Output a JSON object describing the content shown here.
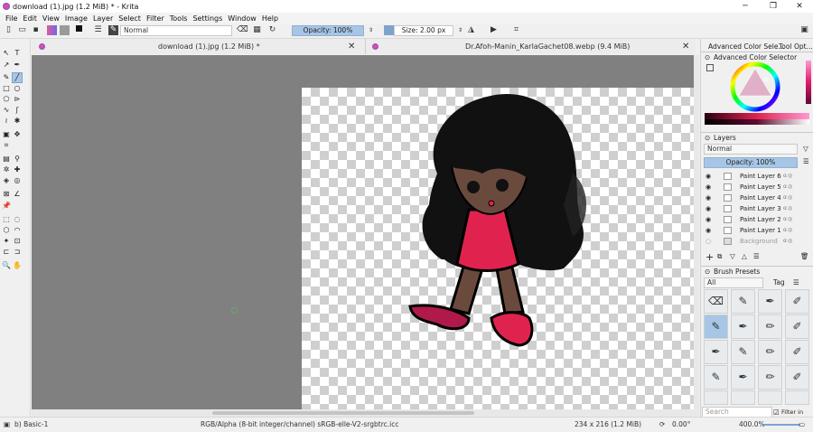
{
  "titlebar": {
    "title": "download (1).jpg (1.2 MiB) * - Krita",
    "minimize": "─",
    "maximize": "❐",
    "close": "✕"
  },
  "menu": [
    "File",
    "Edit",
    "View",
    "Image",
    "Layer",
    "Select",
    "Filter",
    "Tools",
    "Settings",
    "Window",
    "Help"
  ],
  "toolbar": {
    "blend_mode": "Normal",
    "opacity": "Opacity: 100%",
    "size": "Size: 2.00 px"
  },
  "tabs": [
    {
      "label": "download (1).jpg (1.2 MiB) *",
      "close": "✕"
    },
    {
      "label": "Dr.Afoh-Manin_KarlaGachet08.webp (9.4 MiB)",
      "close": "✕"
    }
  ],
  "docker": {
    "top_tabs": [
      "Advanced Color Sele...",
      "Tool Opt..."
    ],
    "color_selector_title": "Advanced Color Selector",
    "layers_title": "Layers",
    "layers_blend": "Normal",
    "layers_opacity": "Opacity:  100%",
    "layers": [
      {
        "name": "Paint Layer 6"
      },
      {
        "name": "Paint Layer 5"
      },
      {
        "name": "Paint Layer 4"
      },
      {
        "name": "Paint Layer 3"
      },
      {
        "name": "Paint Layer 2"
      },
      {
        "name": "Paint Layer 1"
      },
      {
        "name": "Background"
      }
    ],
    "brush_presets_title": "Brush Presets",
    "brush_filter": "All",
    "brush_tag": "Tag",
    "search_placeholder": "Search",
    "filter_in_tag": "Filter in Tag"
  },
  "status": {
    "brush": "b) Basic-1",
    "colorspace": "RGB/Alpha (8-bit integer/channel)  sRGB-elle-V2-srgbtrc.icc",
    "dimensions": "234 x 216 (1.2 MiB)",
    "rotation": "0.00°",
    "zoom": "400.0%"
  },
  "colors": {
    "accent": "#a7c6e6",
    "canvas_bg": "#808080",
    "character_hair": "#111111",
    "character_skin": "#6b4a3e",
    "character_dress": "#e0234e"
  }
}
